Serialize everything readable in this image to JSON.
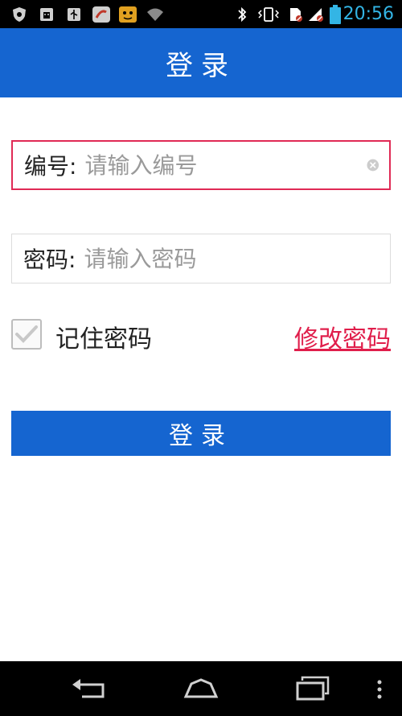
{
  "status_bar": {
    "time": "20:56",
    "icons": [
      "shield-icon",
      "android-debug-icon",
      "usb-icon",
      "notification-app-icon",
      "tiger-app-icon",
      "wifi-icon",
      "bluetooth-icon",
      "vibrate-icon",
      "sim-no-signal-icon",
      "no-signal-icon",
      "battery-icon"
    ]
  },
  "header": {
    "title": "登录"
  },
  "form": {
    "id_label": "编号:",
    "id_placeholder": "请输入编号",
    "password_label": "密码:",
    "password_placeholder": "请输入密码",
    "remember_label": "记住密码",
    "remember_checked": true,
    "change_password_link": "修改密码",
    "login_button": "登录"
  },
  "colors": {
    "primary": "#1565d0",
    "accent": "#e01e4b",
    "time": "#33b5e5"
  },
  "nav_bar": {
    "buttons": [
      "back-icon",
      "home-icon",
      "recent-apps-icon",
      "menu-icon"
    ]
  }
}
